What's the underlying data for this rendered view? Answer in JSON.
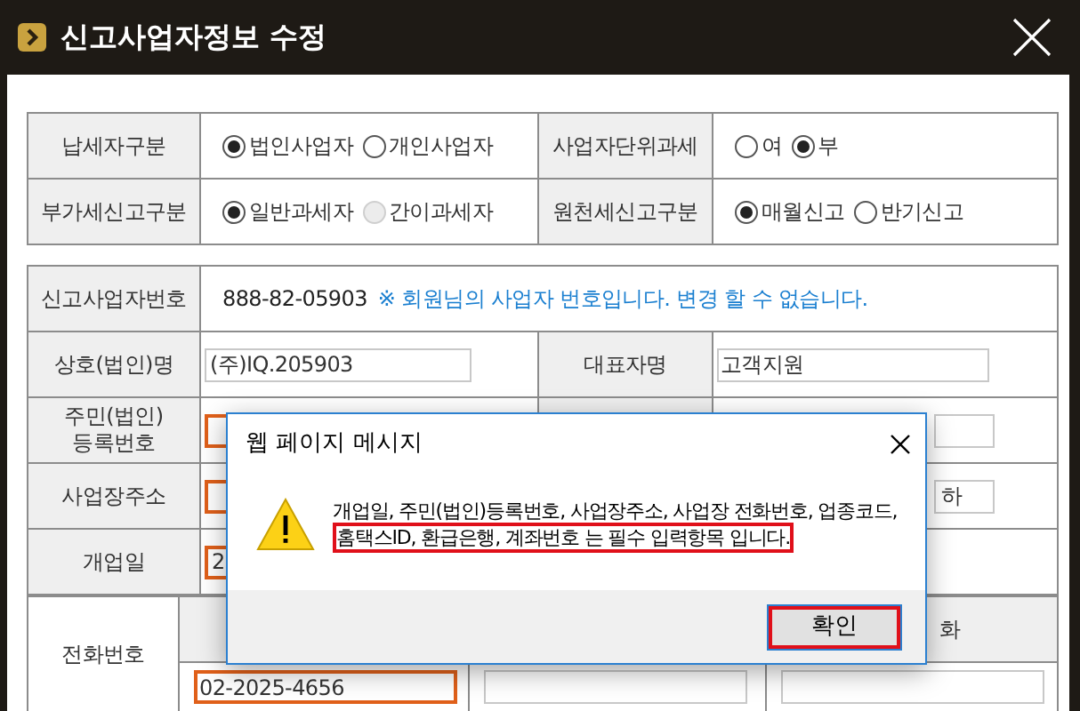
{
  "window": {
    "title": "신고사업자정보 수정"
  },
  "tax_settings": [
    {
      "label": "납세자구분",
      "options": [
        {
          "label": "법인사업자",
          "selected": true,
          "disabled": false
        },
        {
          "label": "개인사업자",
          "selected": false,
          "disabled": false
        }
      ]
    },
    {
      "label": "사업자단위과세",
      "options": [
        {
          "label": "여",
          "selected": false,
          "disabled": false
        },
        {
          "label": "부",
          "selected": true,
          "disabled": false
        }
      ]
    },
    {
      "label": "부가세신고구분",
      "options": [
        {
          "label": "일반과세자",
          "selected": true,
          "disabled": false
        },
        {
          "label": "간이과세자",
          "selected": false,
          "disabled": true
        }
      ]
    },
    {
      "label": "원천세신고구분",
      "options": [
        {
          "label": "매월신고",
          "selected": true,
          "disabled": false
        },
        {
          "label": "반기신고",
          "selected": false,
          "disabled": false
        }
      ]
    }
  ],
  "business_number": {
    "label": "신고사업자번호",
    "value": "888-82-05903",
    "note": "※ 회원님의 사업자 번호입니다. 변경 할 수 없습니다."
  },
  "rows": [
    {
      "label": "상호(법인)명",
      "value": "(주)IQ.205903",
      "required": false,
      "right_label": "대표자명",
      "right_input": true,
      "right_value": "고객지원"
    },
    {
      "label": "주민(법인) 등록번호",
      "required": true,
      "right_input": true
    },
    {
      "label": "사업장주소",
      "required": true,
      "right_input": true,
      "right_value": "하"
    },
    {
      "label": "개업일",
      "value": "2",
      "required": true,
      "right_input": false
    }
  ],
  "phone": {
    "label": "전화번호",
    "column_3": "화",
    "inputs": [
      {
        "value": "02-2025-4656",
        "required": true
      },
      {
        "required": false
      },
      {
        "required": false
      }
    ]
  },
  "dialog": {
    "title": "웹 페이지 메시지",
    "message": "개업일, 주민(법인)등록번호, 사업장주소, 사업장 전화번호, 업종코드,",
    "highlight": "홈택스ID, 환급은행, 계좌번호 는 필수 입력항목 입니다.",
    "button": "확인"
  }
}
